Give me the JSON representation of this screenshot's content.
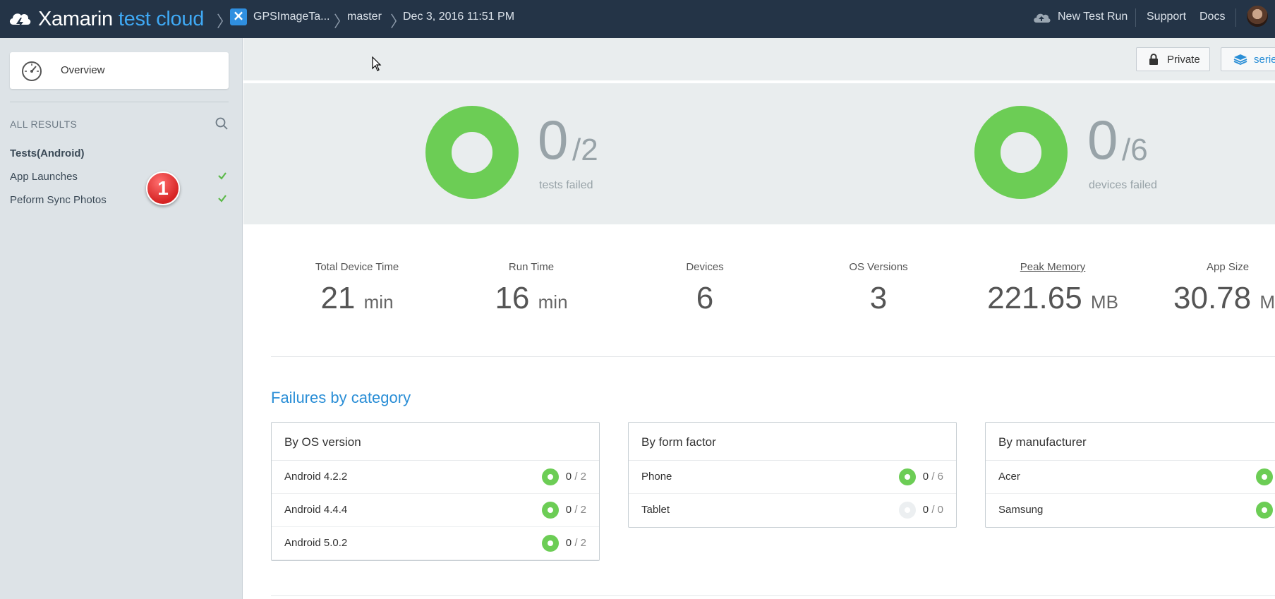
{
  "header": {
    "brand_primary": "Xamarin",
    "brand_secondary": "test cloud",
    "breadcrumb": [
      "GPSImageTa...",
      "master",
      "Dec 3, 2016 11:51 PM"
    ],
    "new_test_run": "New Test Run",
    "support": "Support",
    "docs": "Docs"
  },
  "sidebar": {
    "overview": "Overview",
    "all_results": "ALL RESULTS",
    "group_title": "Tests(Android)",
    "items": [
      {
        "label": "App Launches",
        "status": "passed"
      },
      {
        "label": "Peform Sync Photos",
        "status": "passed"
      }
    ],
    "badge": "1"
  },
  "toolbar": {
    "private_label": "Private",
    "series_label": "serie"
  },
  "summary": {
    "tests": {
      "failed": "0",
      "total": "/2",
      "label": "tests failed",
      "failed_fraction": 0
    },
    "devices": {
      "failed": "0",
      "total": "/6",
      "label": "devices failed",
      "failed_fraction": 0
    }
  },
  "stats": [
    {
      "label": "Total Device Time",
      "value": "21",
      "unit": "min"
    },
    {
      "label": "Run Time",
      "value": "16",
      "unit": "min"
    },
    {
      "label": "Devices",
      "value": "6",
      "unit": ""
    },
    {
      "label": "OS Versions",
      "value": "3",
      "unit": ""
    },
    {
      "label": "Peak Memory",
      "value": "221.65",
      "unit": "MB"
    },
    {
      "label": "App Size",
      "value": "30.78",
      "unit": "MB"
    }
  ],
  "failures": {
    "title": "Failures by category",
    "os": {
      "title": "By OS version",
      "rows": [
        {
          "label": "Android 4.2.2",
          "failed": "0",
          "total": "2"
        },
        {
          "label": "Android 4.4.4",
          "failed": "0",
          "total": "2"
        },
        {
          "label": "Android 5.0.2",
          "failed": "0",
          "total": "2"
        }
      ]
    },
    "form": {
      "title": "By form factor",
      "rows": [
        {
          "label": "Phone",
          "failed": "0",
          "total": "6"
        },
        {
          "label": "Tablet",
          "failed": "0",
          "total": "0"
        }
      ]
    },
    "manufacturer": {
      "title": "By manufacturer",
      "rows": [
        {
          "label": "Acer"
        },
        {
          "label": "Samsung"
        }
      ]
    }
  },
  "colors": {
    "nav_bg": "#243447",
    "accent": "#3fa9f5",
    "pass_green": "#6ccd55",
    "sidebar_bg": "#dde3e7"
  }
}
